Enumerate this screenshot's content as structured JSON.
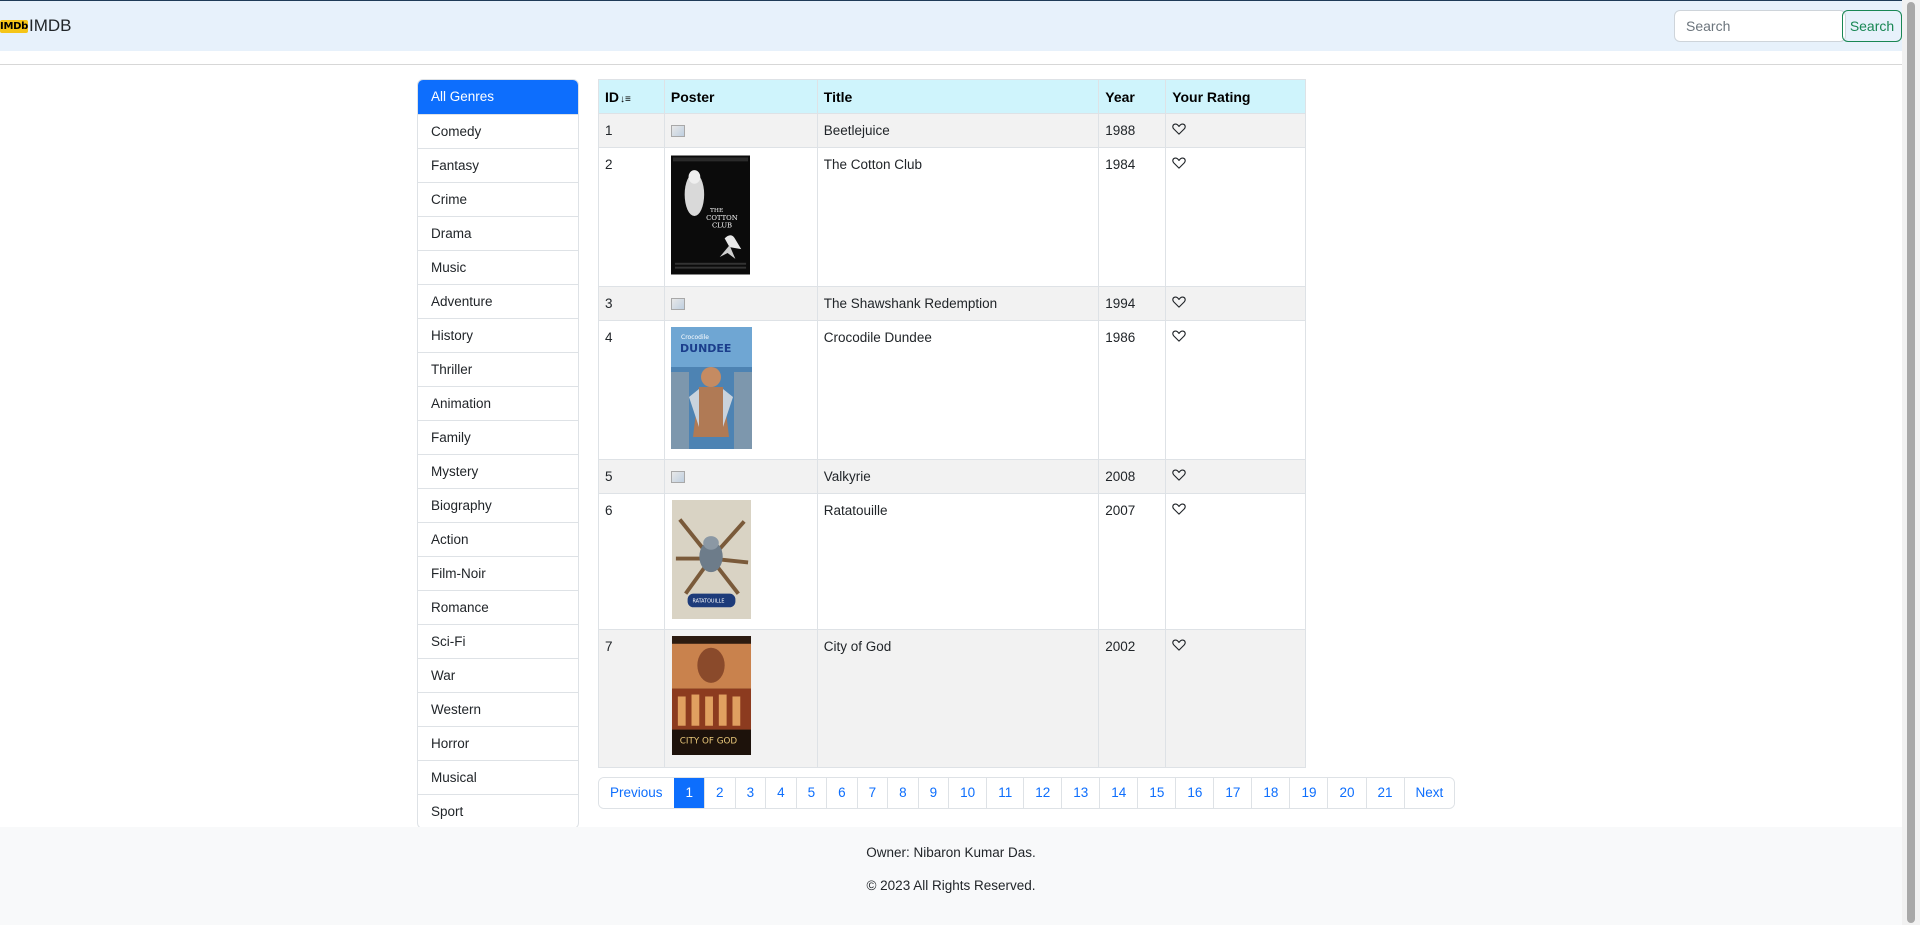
{
  "navbar": {
    "logo_text": "IMDb",
    "brand": "IMDB",
    "search_placeholder": "Search",
    "search_button": "Search"
  },
  "genres": [
    "All Genres",
    "Comedy",
    "Fantasy",
    "Crime",
    "Drama",
    "Music",
    "Adventure",
    "History",
    "Thriller",
    "Animation",
    "Family",
    "Mystery",
    "Biography",
    "Action",
    "Film-Noir",
    "Romance",
    "Sci-Fi",
    "War",
    "Western",
    "Horror",
    "Musical",
    "Sport"
  ],
  "active_genre": "All Genres",
  "table": {
    "headers": {
      "id": "ID",
      "poster": "Poster",
      "title": "Title",
      "year": "Year",
      "rating": "Your Rating"
    },
    "rows": [
      {
        "id": "1",
        "title": "Beetlejuice",
        "year": "1988",
        "poster": "broken",
        "poster_lines": []
      },
      {
        "id": "2",
        "title": "The Cotton Club",
        "year": "1984",
        "poster": "cotton-club",
        "poster_lines": [
          "THE",
          "COTTON",
          "CLUB"
        ]
      },
      {
        "id": "3",
        "title": "The Shawshank Redemption",
        "year": "1994",
        "poster": "broken",
        "poster_lines": []
      },
      {
        "id": "4",
        "title": "Crocodile Dundee",
        "year": "1986",
        "poster": "crocodile-dundee",
        "poster_lines": [
          "Crocodile",
          "DUNDEE"
        ]
      },
      {
        "id": "5",
        "title": "Valkyrie",
        "year": "2008",
        "poster": "broken",
        "poster_lines": []
      },
      {
        "id": "6",
        "title": "Ratatouille",
        "year": "2007",
        "poster": "ratatouille",
        "poster_lines": [
          "RATATOUILLE"
        ]
      },
      {
        "id": "7",
        "title": "City of God",
        "year": "2002",
        "poster": "city-of-god",
        "poster_lines": [
          "CITY OF GOD"
        ]
      }
    ]
  },
  "pagination": {
    "previous": "Previous",
    "pages": [
      "1",
      "2",
      "3",
      "4",
      "5",
      "6",
      "7",
      "8",
      "9",
      "10",
      "11",
      "12",
      "13",
      "14",
      "15",
      "16",
      "17",
      "18",
      "19",
      "20",
      "21"
    ],
    "active": "1",
    "next": "Next"
  },
  "footer": {
    "owner": "Owner: Nibaron Kumar Das.",
    "copyright": "© 2023 All Rights Reserved."
  },
  "colors": {
    "primary": "#0d6efd",
    "header_bg": "#cff4fc",
    "navbar_bg": "#e7f1fb",
    "success": "#198754",
    "imdb_yellow": "#f5c518"
  }
}
